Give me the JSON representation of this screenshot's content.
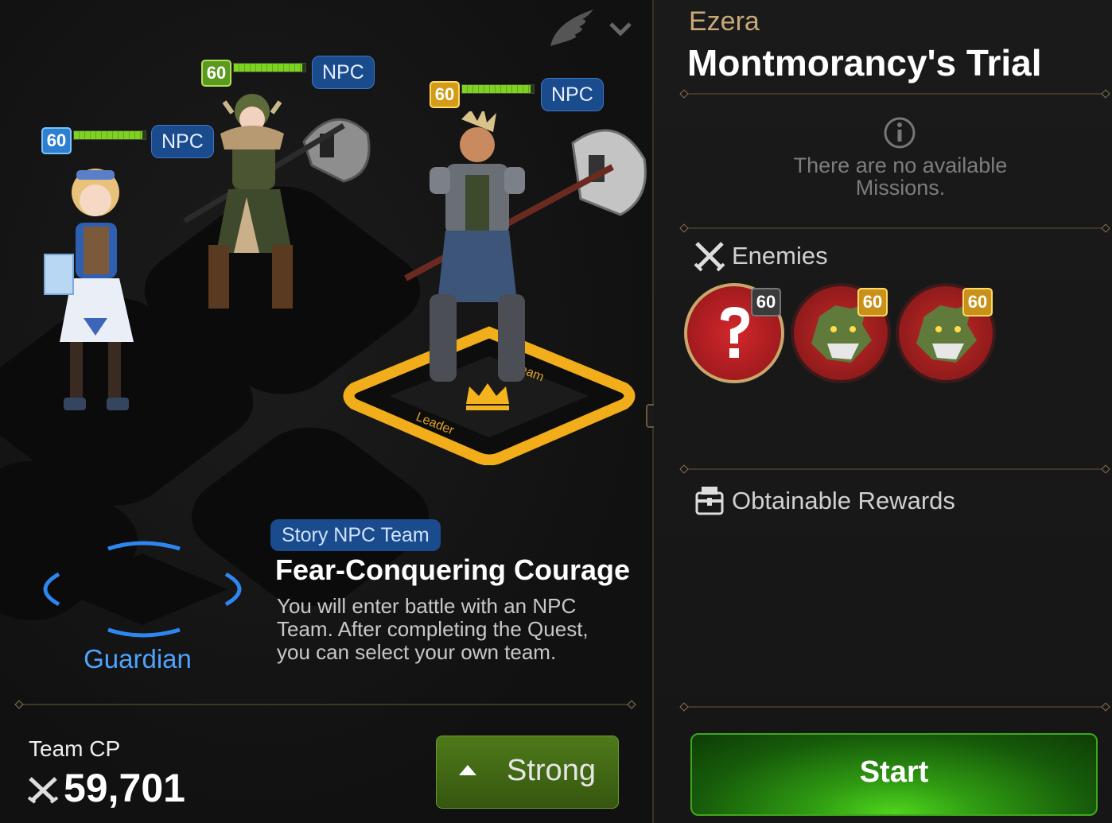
{
  "header": {
    "icons": [
      "wing-icon",
      "chevron-down-icon"
    ]
  },
  "party": [
    {
      "level": "60",
      "tag": "NPC",
      "level_color": "#2d7fcf",
      "hp_fraction": 0.95
    },
    {
      "level": "60",
      "tag": "NPC",
      "level_color": "#5b9a1e",
      "hp_fraction": 0.95
    },
    {
      "level": "60",
      "tag": "NPC",
      "level_color": "#d39b18",
      "hp_fraction": 0.95
    }
  ],
  "leader_slot": {
    "label_team": "Team",
    "label_leader": "Leader"
  },
  "guardian": {
    "label": "Guardian"
  },
  "team_info": {
    "badge": "Story NPC Team",
    "title": "Fear-Conquering Courage",
    "description": "You will enter battle with an NPC Team. After completing the Quest, you can select your own team."
  },
  "footer": {
    "cp_label": "Team CP",
    "cp_value": "59,701",
    "strength_label": "Strong"
  },
  "quest": {
    "region": "Ezera",
    "title": "Montmorancy's Trial",
    "missions_empty": "There are no available Missions.",
    "enemies_label": "Enemies",
    "enemies": [
      {
        "level": "60",
        "portrait": "unknown-question"
      },
      {
        "level": "60",
        "portrait": "dragon-beast"
      },
      {
        "level": "60",
        "portrait": "dragon-beast"
      }
    ],
    "rewards_label": "Obtainable Rewards",
    "start_label": "Start"
  },
  "colors": {
    "accent_blue": "#4da3ff",
    "gold": "#f5b41e",
    "start_green": "#2f9a12"
  }
}
